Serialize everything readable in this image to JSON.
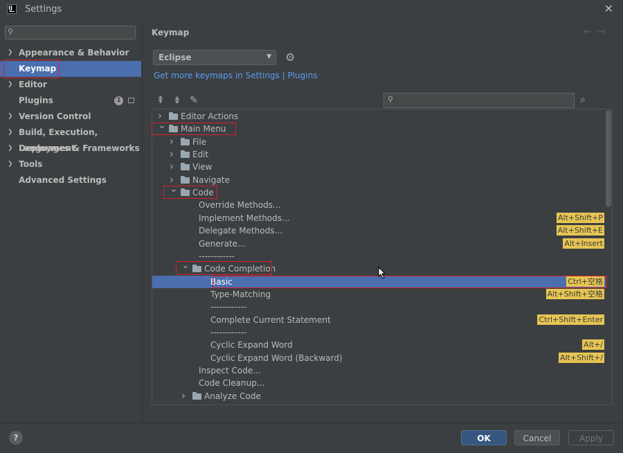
{
  "window": {
    "title": "Settings",
    "app_icon_text": "IJ"
  },
  "sidebar": {
    "search_placeholder": "",
    "items": [
      {
        "label": "Appearance & Behavior",
        "expandable": true
      },
      {
        "label": "Keymap",
        "expandable": false,
        "selected": true
      },
      {
        "label": "Editor",
        "expandable": true
      },
      {
        "label": "Plugins",
        "expandable": false,
        "badge": "1"
      },
      {
        "label": "Version Control",
        "expandable": true
      },
      {
        "label": "Build, Execution, Deployment",
        "expandable": true
      },
      {
        "label": "Languages & Frameworks",
        "expandable": true
      },
      {
        "label": "Tools",
        "expandable": true
      },
      {
        "label": "Advanced Settings",
        "expandable": false
      }
    ]
  },
  "main": {
    "title": "Keymap",
    "keymap_select": "Eclipse",
    "link_text": "Get more keymaps in Settings | Plugins",
    "tree_search_placeholder": ""
  },
  "tree": [
    {
      "label": "Editor Actions",
      "chevron": "right",
      "icon": "special-folder",
      "level": 0
    },
    {
      "label": "Main Menu",
      "chevron": "down",
      "icon": "special-folder",
      "level": 0
    },
    {
      "label": "File",
      "chevron": "right",
      "icon": "folder",
      "level": 1
    },
    {
      "label": "Edit",
      "chevron": "right",
      "icon": "folder",
      "level": 1
    },
    {
      "label": "View",
      "chevron": "right",
      "icon": "folder",
      "level": 1
    },
    {
      "label": "Navigate",
      "chevron": "right",
      "icon": "folder",
      "level": 1
    },
    {
      "label": "Code",
      "chevron": "down",
      "icon": "folder",
      "level": 1
    },
    {
      "label": "Override Methods...",
      "level": 2
    },
    {
      "label": "Implement Methods...",
      "level": 2,
      "shortcut": "Alt+Shift+P"
    },
    {
      "label": "Delegate Methods...",
      "level": 2,
      "shortcut": "Alt+Shift+E"
    },
    {
      "label": "Generate...",
      "level": 2,
      "shortcut": "Alt+Insert"
    },
    {
      "label": "------------",
      "level": 2
    },
    {
      "label": "Code Completion",
      "chevron": "down",
      "icon": "folder",
      "level": 2
    },
    {
      "label": "Basic",
      "level": 3,
      "shortcut": "Ctrl+空格",
      "selected": true
    },
    {
      "label": "Type-Matching",
      "level": 3,
      "shortcut": "Alt+Shift+空格"
    },
    {
      "label": "------------",
      "level": 3
    },
    {
      "label": "Complete Current Statement",
      "level": 3,
      "shortcut": "Ctrl+Shift+Enter"
    },
    {
      "label": "------------",
      "level": 3
    },
    {
      "label": "Cyclic Expand Word",
      "level": 3,
      "shortcut": "Alt+/"
    },
    {
      "label": "Cyclic Expand Word (Backward)",
      "level": 3,
      "shortcut": "Alt+Shift+/"
    },
    {
      "label": "Inspect Code...",
      "level": 2
    },
    {
      "label": "Code Cleanup...",
      "level": 2
    },
    {
      "label": "Analyze Code",
      "chevron": "right",
      "icon": "folder",
      "level": 2
    }
  ],
  "footer": {
    "help": "?",
    "ok": "OK",
    "cancel": "Cancel",
    "apply": "Apply"
  },
  "colors": {
    "accent": "#4b6eaf",
    "highlight_box": "#d5222c",
    "shortcut_bg": "#e6c552",
    "link": "#589df6"
  }
}
